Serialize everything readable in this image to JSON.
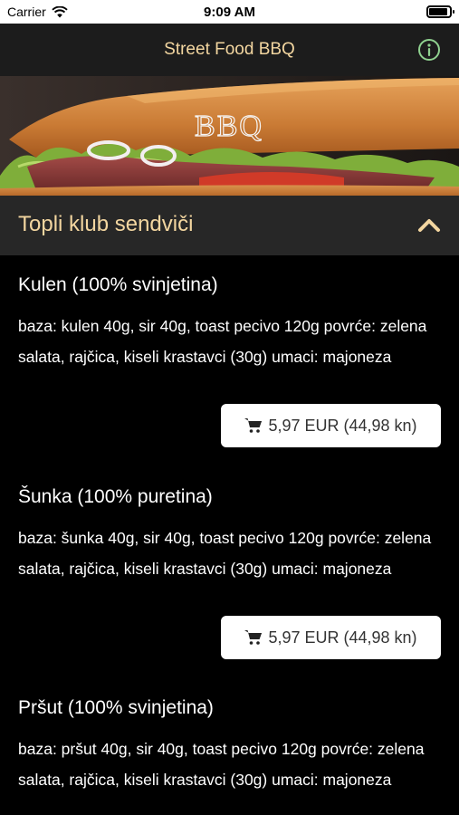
{
  "status_bar": {
    "carrier": "Carrier",
    "time": "9:09 AM"
  },
  "nav": {
    "title": "Street Food BBQ",
    "info_icon": "info-circle-icon"
  },
  "hero": {
    "logo_text": "BBQ"
  },
  "section": {
    "title": "Topli klub sendviči",
    "chevron_icon": "chevron-up-icon"
  },
  "items": [
    {
      "name": "Kulen (100% svinjetina)",
      "description": "baza: kulen 40g, sir 40g, toast pecivo 120g povrće: zelena salata, rajčica, kiseli krastavci (30g) umaci: majoneza",
      "price": "5,97 EUR (44,98 kn)"
    },
    {
      "name": "Šunka (100% puretina)",
      "description": "baza: šunka 40g, sir 40g, toast pecivo 120g povrće: zelena salata, rajčica, kiseli krastavci (30g) umaci: majoneza",
      "price": "5,97 EUR (44,98 kn)"
    },
    {
      "name": "Pršut (100% svinjetina)",
      "description": "baza: pršut 40g, sir 40g, toast pecivo 120g povrće: zelena salata, rajčica, kiseli krastavci (30g) umaci: majoneza"
    }
  ],
  "colors": {
    "accent": "#f3d6a0",
    "nav_bg": "#1c1c1c",
    "section_bg": "#272727",
    "info_icon": "#8fd18f"
  }
}
